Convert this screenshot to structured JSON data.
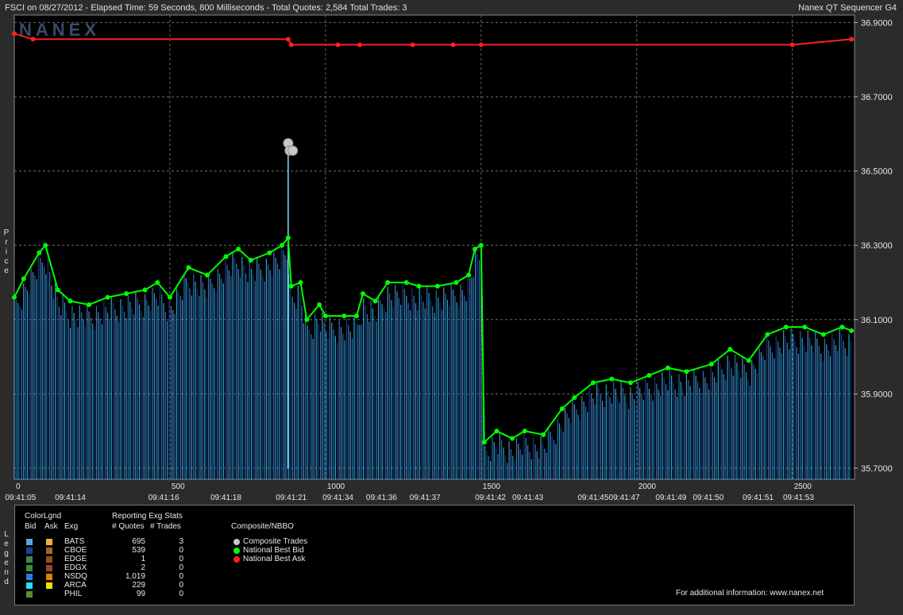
{
  "header": {
    "title": "FSCI on 08/27/2012  -  Elapsed Time: 59 Seconds, 800 Milliseconds  -  Total Quotes: 2,584  Total Trades: 3",
    "app_name": "Nanex QT Sequencer G4",
    "watermark": "NANEX"
  },
  "axis": {
    "y_label_letters": [
      "P",
      "r",
      "i",
      "c",
      "e"
    ]
  },
  "chart_data": {
    "type": "line",
    "ylim": [
      35.67,
      36.92
    ],
    "xlim": [
      0,
      2700
    ],
    "y_ticks": [
      "36.9000",
      "36.7000",
      "36.5000",
      "36.3000",
      "36.1000",
      "35.9000",
      "35.7000"
    ],
    "y_tick_values": [
      36.9,
      36.7,
      36.5,
      36.3,
      36.1,
      35.9,
      35.7
    ],
    "x_ticks": [
      "0",
      "500",
      "1000",
      "1500",
      "2000",
      "2500"
    ],
    "x_tick_values": [
      0,
      500,
      1000,
      1500,
      2000,
      2500
    ],
    "time_labels": [
      "09:41:05",
      "09:41:14",
      "09:41:16",
      "09:41:18",
      "09:41:21",
      "09:41:34",
      "09:41:36",
      "09:41:37",
      "09:41:42",
      "09:41:43",
      "09:41:45",
      "09:41:47",
      "09:41:49",
      "09:41:50",
      "09:41:51",
      "09:41:53"
    ],
    "time_label_x": [
      20,
      180,
      480,
      680,
      890,
      1040,
      1180,
      1320,
      1530,
      1650,
      1860,
      1960,
      2110,
      2230,
      2390,
      2520
    ],
    "grid": true,
    "series": [
      {
        "name": "National Best Bid",
        "color": "#00ff00",
        "points": [
          [
            0,
            36.16
          ],
          [
            30,
            36.21
          ],
          [
            80,
            36.28
          ],
          [
            100,
            36.3
          ],
          [
            140,
            36.18
          ],
          [
            180,
            36.15
          ],
          [
            240,
            36.14
          ],
          [
            300,
            36.16
          ],
          [
            360,
            36.17
          ],
          [
            420,
            36.18
          ],
          [
            460,
            36.2
          ],
          [
            500,
            36.16
          ],
          [
            560,
            36.24
          ],
          [
            620,
            36.22
          ],
          [
            680,
            36.27
          ],
          [
            720,
            36.29
          ],
          [
            760,
            36.26
          ],
          [
            820,
            36.28
          ],
          [
            860,
            36.3
          ],
          [
            880,
            36.32
          ],
          [
            890,
            36.19
          ],
          [
            920,
            36.2
          ],
          [
            940,
            36.1
          ],
          [
            980,
            36.14
          ],
          [
            1000,
            36.11
          ],
          [
            1060,
            36.11
          ],
          [
            1100,
            36.11
          ],
          [
            1120,
            36.17
          ],
          [
            1160,
            36.15
          ],
          [
            1200,
            36.2
          ],
          [
            1260,
            36.2
          ],
          [
            1300,
            36.19
          ],
          [
            1360,
            36.19
          ],
          [
            1420,
            36.2
          ],
          [
            1460,
            36.22
          ],
          [
            1480,
            36.29
          ],
          [
            1500,
            36.3
          ],
          [
            1510,
            35.77
          ],
          [
            1550,
            35.8
          ],
          [
            1600,
            35.78
          ],
          [
            1640,
            35.8
          ],
          [
            1700,
            35.79
          ],
          [
            1760,
            35.86
          ],
          [
            1800,
            35.89
          ],
          [
            1860,
            35.93
          ],
          [
            1920,
            35.94
          ],
          [
            1980,
            35.93
          ],
          [
            2040,
            35.95
          ],
          [
            2100,
            35.97
          ],
          [
            2160,
            35.96
          ],
          [
            2240,
            35.98
          ],
          [
            2300,
            36.02
          ],
          [
            2360,
            35.99
          ],
          [
            2420,
            36.06
          ],
          [
            2480,
            36.08
          ],
          [
            2540,
            36.08
          ],
          [
            2600,
            36.06
          ],
          [
            2660,
            36.08
          ],
          [
            2690,
            36.07
          ]
        ]
      },
      {
        "name": "National Best Ask",
        "color": "#ff2020",
        "points": [
          [
            0,
            36.87
          ],
          [
            60,
            36.855
          ],
          [
            880,
            36.855
          ],
          [
            890,
            36.84
          ],
          [
            1040,
            36.84
          ],
          [
            1110,
            36.84
          ],
          [
            1280,
            36.84
          ],
          [
            1410,
            36.84
          ],
          [
            1500,
            36.84
          ],
          [
            2500,
            36.84
          ],
          [
            2690,
            36.855
          ]
        ]
      },
      {
        "name": "Composite Trades",
        "color": "#c8c8c8",
        "points": [
          [
            880,
            36.575
          ],
          [
            885,
            36.555
          ],
          [
            895,
            36.555
          ]
        ]
      }
    ],
    "bid_spike": [
      [
        880,
        35.7
      ],
      [
        880,
        36.55
      ]
    ],
    "legend_entries": [
      "Composite Trades",
      "National Best Bid",
      "National Best Ask"
    ]
  },
  "legend": {
    "title": "ColorLgnd",
    "col_bid": "Bid",
    "col_ask": "Ask",
    "col_exg": "Exg",
    "stats_title": "Reporting Exg Stats",
    "col_quotes": "# Quotes",
    "col_trades": "# Trades",
    "composite_title": "Composite/NBBO",
    "rows": [
      {
        "exg": "BATS",
        "quotes": "695",
        "trades": "3",
        "bid_color": "#5aa6e8",
        "ask_color": "#f0b040"
      },
      {
        "exg": "CBOE",
        "quotes": "539",
        "trades": "0",
        "bid_color": "#1f3f9a",
        "ask_color": "#a06820"
      },
      {
        "exg": "EDGE",
        "quotes": "1",
        "trades": "0",
        "bid_color": "#3a8a50",
        "ask_color": "#905020"
      },
      {
        "exg": "EDGX",
        "quotes": "2",
        "trades": "0",
        "bid_color": "#3f8a3f",
        "ask_color": "#a04030"
      },
      {
        "exg": "NSDQ",
        "quotes": "1,019",
        "trades": "0",
        "bid_color": "#2a7fd0",
        "ask_color": "#e08000"
      },
      {
        "exg": "ARCA",
        "quotes": "229",
        "trades": "0",
        "bid_color": "#20e0ff",
        "ask_color": "#f0e000"
      },
      {
        "exg": "PHIL",
        "quotes": "99",
        "trades": "0",
        "bid_color": "#5a8a3a",
        "ask_color": ""
      }
    ],
    "composite_items": [
      {
        "label": "Composite Trades",
        "color": "#c8c8c8"
      },
      {
        "label": "National Best Bid",
        "color": "#00ff00"
      },
      {
        "label": "National Best Ask",
        "color": "#ff2020"
      }
    ],
    "info_text": "For additional information: www.nanex.net",
    "vertical_label_letters": [
      "L",
      "e",
      "g",
      "e",
      "n",
      "d"
    ]
  }
}
